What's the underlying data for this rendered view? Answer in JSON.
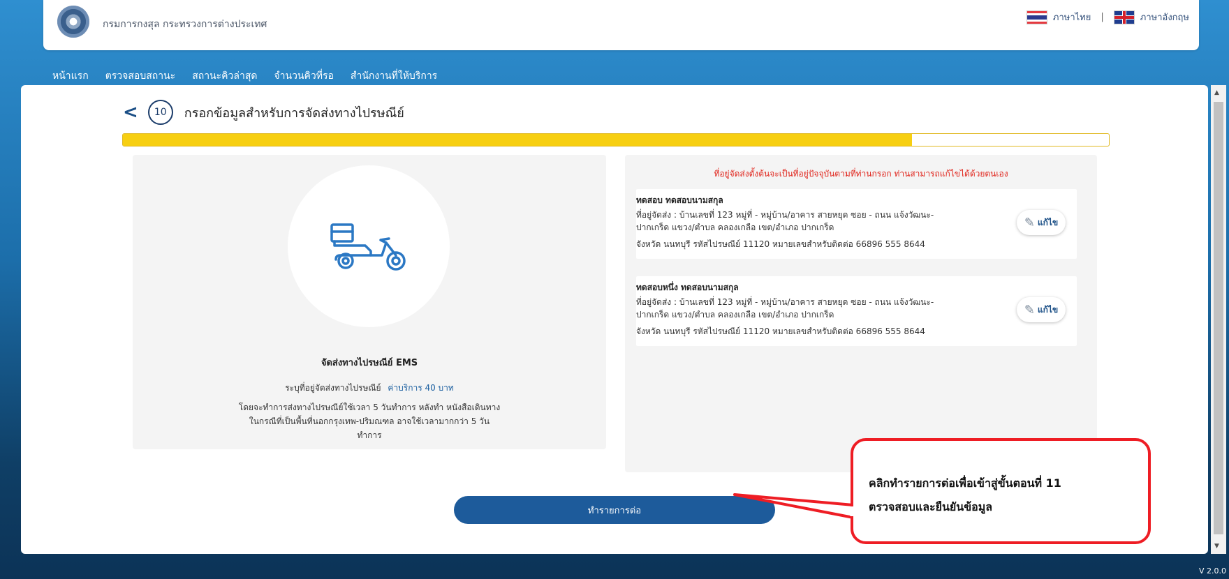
{
  "header": {
    "department": "กรมการกงสุล กระทรวงการต่างประเทศ",
    "lang_th": "ภาษาไทย",
    "lang_sep": "|",
    "lang_en": "ภาษาอังกฤษ"
  },
  "nav": {
    "items": [
      "หน้าแรก",
      "ตรวจสอบสถานะ",
      "สถานะคิวล่าสุด",
      "จำนวนคิวที่รอ",
      "สำนักงานที่ให้บริการ"
    ]
  },
  "step": {
    "back": "<",
    "number": "10",
    "title": "กรอกข้อมูลสำหรับการจัดส่งทางไปรษณีย์",
    "progress_percent": 80
  },
  "delivery": {
    "title": "จัดส่งทางไปรษณีย์ EMS",
    "line": "ระบุที่อยู่จัดส่งทางไปรษณีย์",
    "fee": "ค่าบริการ 40 บาท",
    "description": "โดยจะทำการส่งทางไปรษณีย์ใช้เวลา 5 วันทำการ หลังทำ หนังสือเดินทาง ในกรณีที่เป็นพื้นที่นอกกรุงเทพ-ปริมณฑล อาจใช้เวลามากกว่า 5 วัน ทำการ"
  },
  "addresses": {
    "notice": "ที่อยู่จัดส่งตั้งต้นจะเป็นที่อยู่ปัจจุบันตามที่ท่านกรอก ท่านสามารถแก้ไขได้ด้วยตนเอง",
    "edit_label": "แก้ไข",
    "items": [
      {
        "name": "ทดสอบ ทดสอบนามสกุล",
        "line1": "ที่อยู่จัดส่ง :  บ้านเลขที่ 123  หมู่ที่ -  หมู่บ้าน/อาคาร สายหยุด  ซอย - ถนน แจ้งวัฒนะ-",
        "line2": "ปากเกร็ด  แขวง/ตำบล คลองเกลือ  เขต/อำเภอ ปากเกร็ด",
        "line3": "จังหวัด นนทบุรี  รหัสไปรษณีย์ 11120  หมายเลขสำหรับติดต่อ  66896 555 8644"
      },
      {
        "name": "ทดสอบหนึ่ง ทดสอบนามสกุล",
        "line1": "ที่อยู่จัดส่ง :  บ้านเลขที่ 123  หมู่ที่ -  หมู่บ้าน/อาคาร สายหยุด  ซอย - ถนน แจ้งวัฒนะ-",
        "line2": "ปากเกร็ด  แขวง/ตำบล คลองเกลือ  เขต/อำเภอ ปากเกร็ด",
        "line3": "จังหวัด นนทบุรี  รหัสไปรษณีย์ 11120  หมายเลขสำหรับติดต่อ  66896 555 8644"
      }
    ]
  },
  "actions": {
    "continue": "ทำรายการต่อ"
  },
  "callout": {
    "line1": "คลิกทำรายการต่อเพื่อเข้าสู่ขั้นตอนที่ 11",
    "line2": "ตรวจสอบและยืนยันข้อมูล"
  },
  "version": "V 2.0.0",
  "colors": {
    "accent": "#1d5b9b",
    "progress": "#f7cf12",
    "notice": "#e0231a",
    "callout_border": "#ee1d24"
  }
}
